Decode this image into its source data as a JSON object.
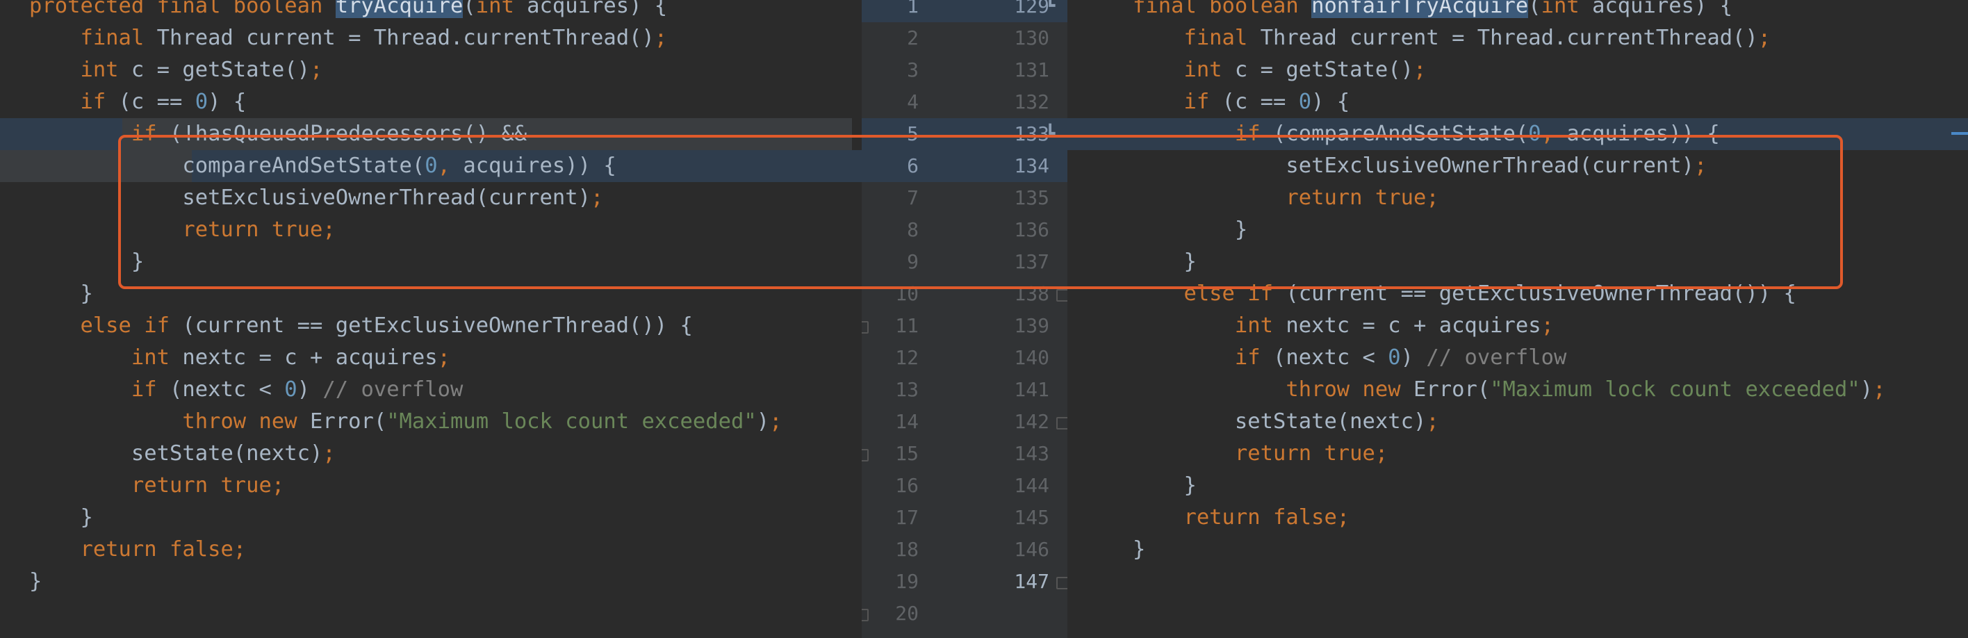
{
  "left_code": [
    [
      {
        "t": "protected final boolean ",
        "c": "kw"
      },
      {
        "t": "tryAcquire",
        "c": "fnhl"
      },
      {
        "t": "(",
        "c": "pl"
      },
      {
        "t": "int ",
        "c": "kw"
      },
      {
        "t": "acquires) {",
        "c": "pl"
      }
    ],
    [
      {
        "t": "    ",
        "c": "pl"
      },
      {
        "t": "final ",
        "c": "kw"
      },
      {
        "t": "Thread current = Thread.currentThread()",
        "c": "pl"
      },
      {
        "t": ";",
        "c": "kw"
      }
    ],
    [
      {
        "t": "    ",
        "c": "pl"
      },
      {
        "t": "int ",
        "c": "kw"
      },
      {
        "t": "c = getState()",
        "c": "pl"
      },
      {
        "t": ";",
        "c": "kw"
      }
    ],
    [
      {
        "t": "    ",
        "c": "pl"
      },
      {
        "t": "if ",
        "c": "kw"
      },
      {
        "t": "(c == ",
        "c": "pl"
      },
      {
        "t": "0",
        "c": "num"
      },
      {
        "t": ") {",
        "c": "pl"
      }
    ],
    [
      {
        "t": "        ",
        "c": "pl"
      },
      {
        "t": "if ",
        "c": "kw"
      },
      {
        "t": "(!hasQueuedPredecessors() &&",
        "c": "pl"
      }
    ],
    [
      {
        "t": "            compareAndSetState(",
        "c": "pl"
      },
      {
        "t": "0",
        "c": "num"
      },
      {
        "t": ", ",
        "c": "kw"
      },
      {
        "t": "acquires)) {",
        "c": "pl"
      }
    ],
    [
      {
        "t": "            setExclusiveOwnerThread(current)",
        "c": "pl"
      },
      {
        "t": ";",
        "c": "kw"
      }
    ],
    [
      {
        "t": "            ",
        "c": "pl"
      },
      {
        "t": "return true;",
        "c": "kw"
      }
    ],
    [
      {
        "t": "        }",
        "c": "pl"
      }
    ],
    [
      {
        "t": "    }",
        "c": "pl"
      }
    ],
    [
      {
        "t": "    ",
        "c": "pl"
      },
      {
        "t": "else if ",
        "c": "kw"
      },
      {
        "t": "(current == getExclusiveOwnerThread()) {",
        "c": "pl"
      }
    ],
    [
      {
        "t": "        ",
        "c": "pl"
      },
      {
        "t": "int ",
        "c": "kw"
      },
      {
        "t": "nextc = c + acquires",
        "c": "pl"
      },
      {
        "t": ";",
        "c": "kw"
      }
    ],
    [
      {
        "t": "        ",
        "c": "pl"
      },
      {
        "t": "if ",
        "c": "kw"
      },
      {
        "t": "(nextc < ",
        "c": "pl"
      },
      {
        "t": "0",
        "c": "num"
      },
      {
        "t": ") ",
        "c": "pl"
      },
      {
        "t": "// overflow",
        "c": "cm"
      }
    ],
    [
      {
        "t": "            ",
        "c": "pl"
      },
      {
        "t": "throw new ",
        "c": "kw"
      },
      {
        "t": "Error(",
        "c": "pl"
      },
      {
        "t": "\"Maximum lock count exceeded\"",
        "c": "str"
      },
      {
        "t": ")",
        "c": "pl"
      },
      {
        "t": ";",
        "c": "kw"
      }
    ],
    [
      {
        "t": "        setState(nextc)",
        "c": "pl"
      },
      {
        "t": ";",
        "c": "kw"
      }
    ],
    [
      {
        "t": "        ",
        "c": "pl"
      },
      {
        "t": "return true;",
        "c": "kw"
      }
    ],
    [
      {
        "t": "    }",
        "c": "pl"
      }
    ],
    [
      {
        "t": "    ",
        "c": "pl"
      },
      {
        "t": "return false;",
        "c": "kw"
      }
    ],
    [
      {
        "t": "}",
        "c": "pl"
      }
    ],
    []
  ],
  "right_code": [
    [
      {
        "t": "final boolean ",
        "c": "kw"
      },
      {
        "t": "nonfairTryAcquire",
        "c": "fnhl"
      },
      {
        "t": "(",
        "c": "pl"
      },
      {
        "t": "int ",
        "c": "kw"
      },
      {
        "t": "acquires) {",
        "c": "pl"
      }
    ],
    [
      {
        "t": "    ",
        "c": "pl"
      },
      {
        "t": "final ",
        "c": "kw"
      },
      {
        "t": "Thread current = Thread.currentThread()",
        "c": "pl"
      },
      {
        "t": ";",
        "c": "kw"
      }
    ],
    [
      {
        "t": "    ",
        "c": "pl"
      },
      {
        "t": "int ",
        "c": "kw"
      },
      {
        "t": "c = getState()",
        "c": "pl"
      },
      {
        "t": ";",
        "c": "kw"
      }
    ],
    [
      {
        "t": "    ",
        "c": "pl"
      },
      {
        "t": "if ",
        "c": "kw"
      },
      {
        "t": "(c == ",
        "c": "pl"
      },
      {
        "t": "0",
        "c": "num"
      },
      {
        "t": ") {",
        "c": "pl"
      }
    ],
    [
      {
        "t": "        ",
        "c": "pl"
      },
      {
        "t": "if ",
        "c": "kw"
      },
      {
        "t": "(compareAndSetState(",
        "c": "pl"
      },
      {
        "t": "0",
        "c": "num"
      },
      {
        "t": ", ",
        "c": "kw"
      },
      {
        "t": "acquires)) {",
        "c": "pl"
      }
    ],
    [
      {
        "t": "            setExclusiveOwnerThread(current)",
        "c": "pl"
      },
      {
        "t": ";",
        "c": "kw"
      }
    ],
    [
      {
        "t": "            ",
        "c": "pl"
      },
      {
        "t": "return true;",
        "c": "kw"
      }
    ],
    [
      {
        "t": "        }",
        "c": "pl"
      }
    ],
    [
      {
        "t": "    }",
        "c": "pl"
      }
    ],
    [
      {
        "t": "    ",
        "c": "pl"
      },
      {
        "t": "else if ",
        "c": "kw"
      },
      {
        "t": "(current == getExclusiveOwnerThread()) {",
        "c": "pl"
      }
    ],
    [
      {
        "t": "        ",
        "c": "pl"
      },
      {
        "t": "int ",
        "c": "kw"
      },
      {
        "t": "nextc = c + acquires",
        "c": "pl"
      },
      {
        "t": ";",
        "c": "kw"
      }
    ],
    [
      {
        "t": "        ",
        "c": "pl"
      },
      {
        "t": "if ",
        "c": "kw"
      },
      {
        "t": "(nextc < ",
        "c": "pl"
      },
      {
        "t": "0",
        "c": "num"
      },
      {
        "t": ") ",
        "c": "pl"
      },
      {
        "t": "// overflow",
        "c": "cm"
      }
    ],
    [
      {
        "t": "            ",
        "c": "pl"
      },
      {
        "t": "throw new ",
        "c": "kw"
      },
      {
        "t": "Error(",
        "c": "pl"
      },
      {
        "t": "\"Maximum lock count exceeded\"",
        "c": "str"
      },
      {
        "t": ")",
        "c": "pl"
      },
      {
        "t": ";",
        "c": "kw"
      }
    ],
    [
      {
        "t": "        setState(nextc)",
        "c": "pl"
      },
      {
        "t": ";",
        "c": "kw"
      }
    ],
    [
      {
        "t": "        ",
        "c": "pl"
      },
      {
        "t": "return true;",
        "c": "kw"
      }
    ],
    [
      {
        "t": "    }",
        "c": "pl"
      }
    ],
    [
      {
        "t": "    ",
        "c": "pl"
      },
      {
        "t": "return false;",
        "c": "kw"
      }
    ],
    [
      {
        "t": "}",
        "c": "pl"
      }
    ],
    [],
    []
  ],
  "gutter": {
    "left_numbers": [
      "1",
      "2",
      "3",
      "4",
      "5",
      "6",
      "7",
      "8",
      "9",
      "10",
      "11",
      "12",
      "13",
      "14",
      "15",
      "16",
      "17",
      "18",
      "19",
      "20"
    ],
    "right_numbers": [
      "129",
      "130",
      "131",
      "132",
      "133",
      "134",
      "135",
      "136",
      "137",
      "138",
      "139",
      "140",
      "141",
      "142",
      "143",
      "144",
      "145",
      "146",
      "147",
      ""
    ]
  },
  "colors": {
    "keyword": "#cc7832",
    "number": "#6897bb",
    "comment": "#808080",
    "string": "#6a8759",
    "plain": "#a9b7c6",
    "change_box": "#e05a2b",
    "modified_bg": "#2f3d4d"
  },
  "icons": {
    "merge_marker": "merge-arrow-icon",
    "fold": "fold-marker-icon"
  }
}
